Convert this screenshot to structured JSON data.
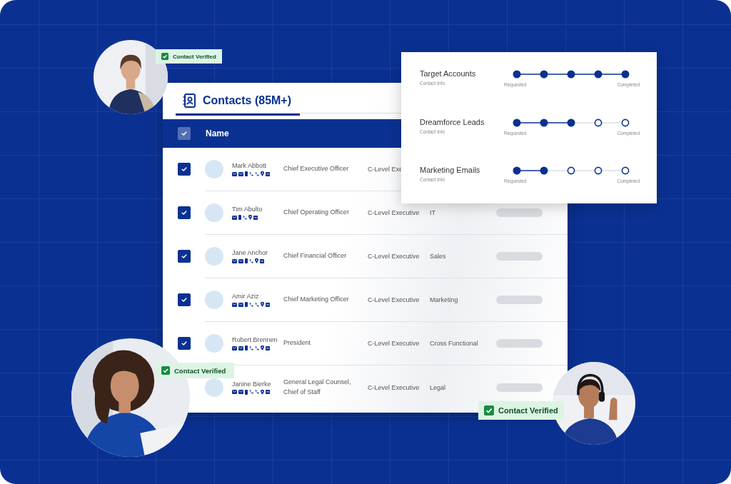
{
  "contacts": {
    "tab": {
      "label": "Contacts (85M+)",
      "selected": true
    },
    "table": {
      "header_checked": true,
      "columns": [
        "Name"
      ],
      "rows": [
        {
          "checked": true,
          "name": "Mark Abbott",
          "title": "Chief Executive Officer",
          "level": "C-Level Exe",
          "department": null,
          "bar": false,
          "contact_icons": [
            {
              "kind": "email"
            },
            {
              "kind": "email"
            },
            {
              "kind": "mobile"
            },
            {
              "kind": "phone"
            },
            {
              "kind": "phone"
            },
            {
              "kind": "location"
            },
            {
              "kind": "card"
            }
          ]
        },
        {
          "checked": true,
          "name": "Tim Abulto",
          "title": "Chief Operating Officer",
          "level": "C-Level Executive",
          "department": "IT",
          "bar": true,
          "contact_icons": [
            {
              "kind": "email"
            },
            {
              "kind": "mobile"
            },
            {
              "kind": "phone"
            },
            {
              "kind": "location"
            },
            {
              "kind": "card"
            }
          ]
        },
        {
          "checked": true,
          "name": "Jane Anchor",
          "title": "Chief Financial Officer",
          "level": "C-Level Executive",
          "department": "Sales",
          "bar": true,
          "contact_icons": [
            {
              "kind": "email"
            },
            {
              "kind": "email"
            },
            {
              "kind": "mobile"
            },
            {
              "kind": "phone"
            },
            {
              "kind": "location"
            },
            {
              "kind": "card"
            }
          ]
        },
        {
          "checked": true,
          "name": "Amir Aziz",
          "title": "Chief Marketing Officer",
          "level": "C-Level Executive",
          "department": "Marketing",
          "bar": true,
          "contact_icons": [
            {
              "kind": "email"
            },
            {
              "kind": "email"
            },
            {
              "kind": "mobile"
            },
            {
              "kind": "phone"
            },
            {
              "kind": "phone"
            },
            {
              "kind": "location"
            },
            {
              "kind": "card"
            }
          ]
        },
        {
          "checked": true,
          "name": "Robert Brennen",
          "title": "President",
          "level": "C-Level Executive",
          "department": "Cross Functional",
          "bar": true,
          "contact_icons": [
            {
              "kind": "email"
            },
            {
              "kind": "email"
            },
            {
              "kind": "mobile"
            },
            {
              "kind": "phone"
            },
            {
              "kind": "phone"
            },
            {
              "kind": "location"
            },
            {
              "kind": "card"
            }
          ]
        },
        {
          "name": "Janine Bierke",
          "title": "General Legal Counsel, Chief of Staff",
          "level": "C-Level Executive",
          "department": "Legal",
          "bar": true,
          "contact_icons": [
            {
              "kind": "email"
            },
            {
              "kind": "email"
            },
            {
              "kind": "mobile"
            },
            {
              "kind": "phone"
            },
            {
              "kind": "phone"
            },
            {
              "kind": "location"
            },
            {
              "kind": "card"
            }
          ]
        }
      ]
    }
  },
  "progress": [
    {
      "title": "Target Accounts",
      "subtitle": "Contact Info",
      "start_label": "Requested",
      "end_label": "Completed",
      "steps": [
        {
          "done": true
        },
        {
          "done": true
        },
        {
          "done": true
        },
        {
          "done": true
        },
        {
          "done": true
        }
      ]
    },
    {
      "title": "Dreamforce Leads",
      "subtitle": "Contact Info",
      "start_label": "Requested",
      "end_label": "Completed",
      "steps": [
        {
          "done": true
        },
        {
          "done": true
        },
        {
          "done": true
        },
        {
          "done": false
        },
        {
          "done": false
        }
      ]
    },
    {
      "title": "Marketing Emails",
      "subtitle": "Contact Info",
      "start_label": "Requested",
      "end_label": "Completed",
      "steps": [
        {
          "done": true
        },
        {
          "done": true
        },
        {
          "done": false
        },
        {
          "done": false
        },
        {
          "done": false
        }
      ]
    }
  ],
  "badges": [
    {
      "label": "Contact Verified"
    },
    {
      "label": "Contact Verified"
    },
    {
      "label": "Contact Verified"
    }
  ]
}
